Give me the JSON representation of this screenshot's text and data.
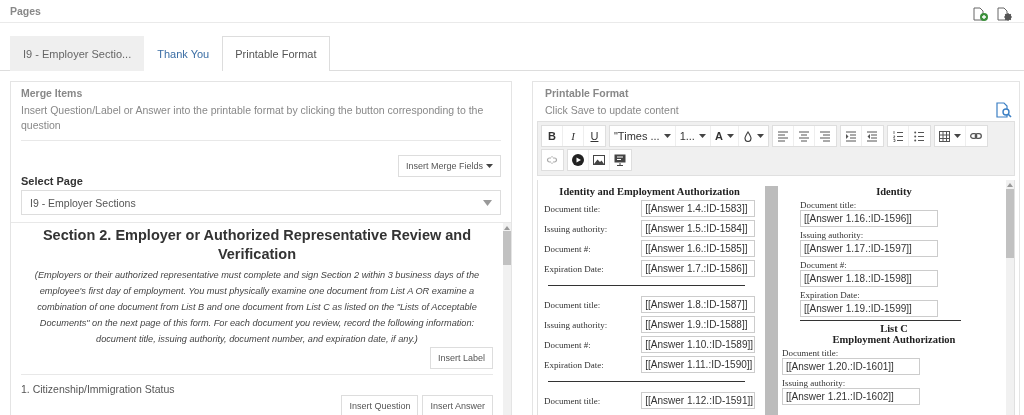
{
  "header": {
    "title": "Pages"
  },
  "tabs": [
    {
      "label": "I9 - Employer Sectio...",
      "selected": false,
      "highlighted": true
    },
    {
      "label": "Thank You",
      "selected": false,
      "highlighted": false
    },
    {
      "label": "Printable Format",
      "selected": true,
      "highlighted": false
    }
  ],
  "merge_items": {
    "title": "Merge Items",
    "description": "Insert Question/Label or Answer into the printable format by clicking the button corresponding to the question",
    "merge_fields_button": "Insert Merge Fields",
    "select_label": "Select Page",
    "select_value": "I9 - Employer Sections",
    "questions": [
      {
        "kind": "label",
        "title": "Section 2. Employer or Authorized Representative Review and Verification",
        "note": "(Employers or their authorized representative must complete and sign Section 2 within 3 business days of the employee's first day of employment. You must physically examine one document from List A OR examine a combination of one document from List B and one document from List C as listed on the \"Lists of Acceptable Documents\" on the next page of this form. For each document you review, record the following information: document title, issuing authority, document number, and expiration date, if any.)",
        "buttons": [
          "Insert Label"
        ]
      },
      {
        "kind": "question",
        "title": "1. Citizenship/Immigration Status",
        "buttons": [
          "Insert Question",
          "Insert Answer"
        ]
      }
    ]
  },
  "printable": {
    "title": "Printable Format",
    "hint": "Click Save to update content",
    "toolbar": [
      [
        [
          {
            "kind": "bold",
            "label": "B",
            "dropdown": false
          },
          {
            "kind": "italic",
            "label": "I",
            "dropdown": false
          },
          {
            "kind": "underline",
            "label": "U",
            "dropdown": false
          }
        ],
        [
          {
            "kind": "select",
            "label": "\"Times ...",
            "dropdown": true
          },
          {
            "kind": "select",
            "label": "1...",
            "dropdown": true
          },
          {
            "kind": "font-color",
            "label": "A",
            "dropdown": true
          },
          {
            "kind": "fill",
            "dropdown": true
          }
        ],
        [
          {
            "kind": "align-left",
            "dropdown": false
          },
          {
            "kind": "align-center",
            "dropdown": false
          },
          {
            "kind": "align-right",
            "dropdown": false
          }
        ],
        [
          {
            "kind": "indent",
            "dropdown": false
          },
          {
            "kind": "outdent",
            "dropdown": false
          }
        ],
        [
          {
            "kind": "ordered-list",
            "dropdown": false
          },
          {
            "kind": "bullet-list",
            "dropdown": false
          }
        ],
        [
          {
            "kind": "table",
            "dropdown": true
          },
          {
            "kind": "link",
            "dropdown": false
          }
        ]
      ],
      [
        [
          {
            "kind": "unlink",
            "dropdown": false
          }
        ],
        [
          {
            "kind": "video",
            "dropdown": false
          },
          {
            "kind": "image",
            "dropdown": false
          },
          {
            "kind": "embed",
            "dropdown": false
          }
        ]
      ]
    ],
    "document": {
      "list_a": {
        "title": "Identity and Employment Authorization",
        "groups": [
          [
            {
              "label": "Document title:",
              "value": "[[Answer 1.4.:ID-1583]]"
            },
            {
              "label": "Issuing authority:",
              "value": "[[Answer 1.5.:ID-1584]]"
            },
            {
              "label": "Document #:",
              "value": "[[Answer 1.6.:ID-1585]]"
            },
            {
              "label": "Expiration Date:",
              "value": "[[Answer 1.7.:ID-1586]]"
            }
          ],
          [
            {
              "label": "Document title:",
              "value": "[[Answer 1.8.:ID-1587]]"
            },
            {
              "label": "Issuing authority:",
              "value": "[[Answer 1.9.:ID-1588]]"
            },
            {
              "label": "Document #:",
              "value": "[[Answer 1.10.:ID-1589]]"
            },
            {
              "label": "Expiration Date:",
              "value": "[[Answer 1.11.:ID-1590]]"
            }
          ],
          [
            {
              "label": "Document title:",
              "value": "[[Answer 1.12.:ID-1591]]"
            }
          ]
        ]
      },
      "list_b": {
        "title": "Identity",
        "fields": [
          {
            "label": "Document title:",
            "value": "[[Answer 1.16.:ID-1596]]"
          },
          {
            "label": "Issuing authority:",
            "value": "[[Answer 1.17.:ID-1597]]"
          },
          {
            "label": "Document #:",
            "value": "[[Answer 1.18.:ID-1598]]"
          },
          {
            "label": "Expiration Date:",
            "value": "[[Answer 1.19.:ID-1599]]"
          }
        ]
      },
      "list_c": {
        "heading": "List C",
        "title": "Employment Authorization",
        "fields": [
          {
            "label": "Document title:",
            "value": "[[Answer 1.20.:ID-1601]]"
          },
          {
            "label": "Issuing authority:",
            "value": "[[Answer 1.21.:ID-1602]]"
          }
        ]
      }
    }
  }
}
